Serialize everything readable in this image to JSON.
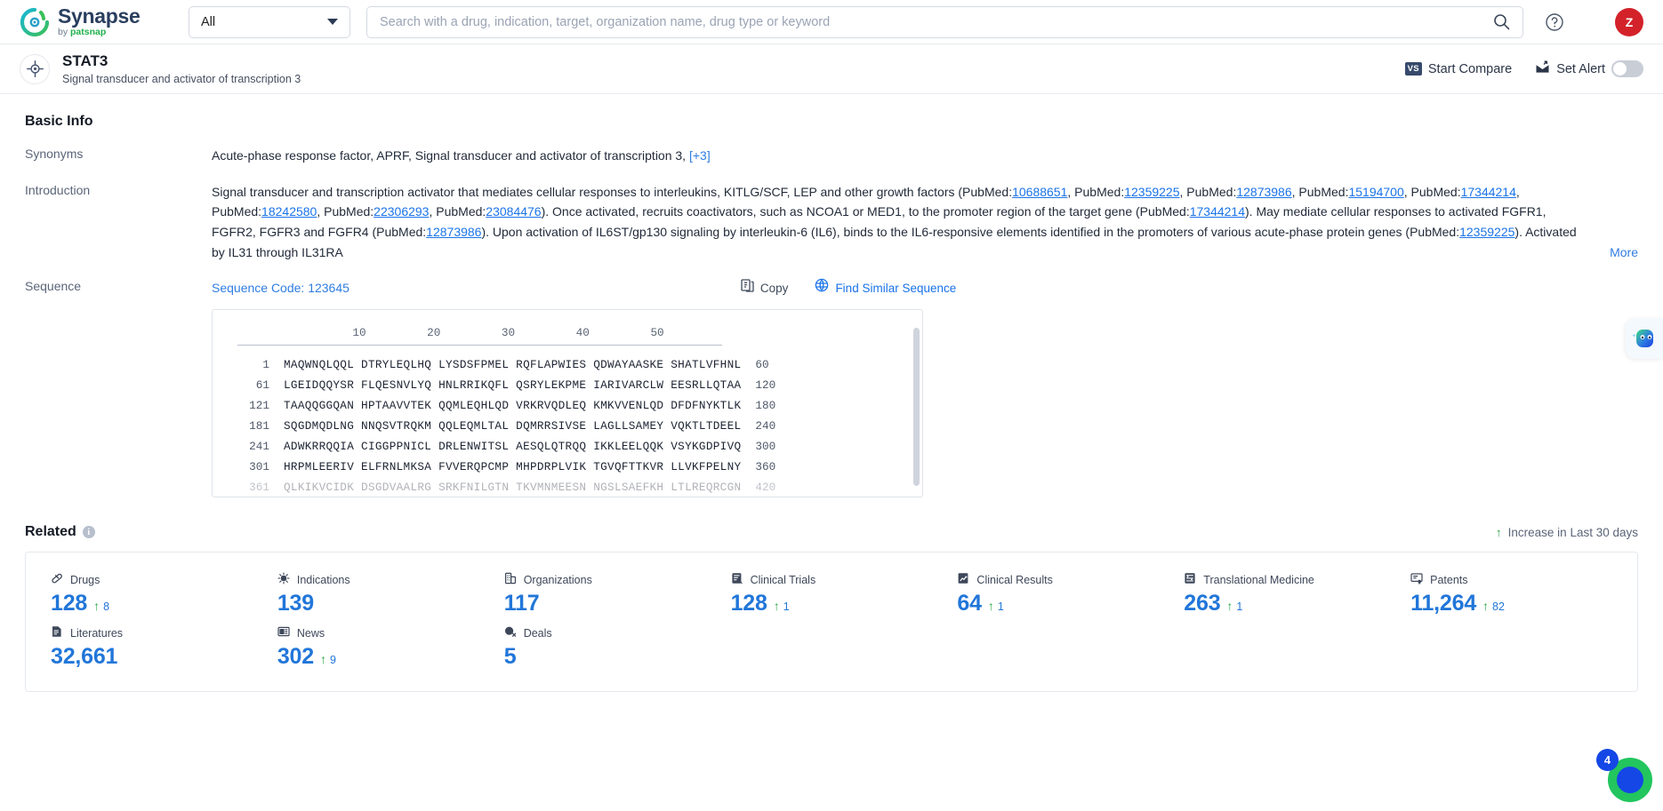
{
  "topbar": {
    "brand_name": "Synapse",
    "brand_sub_prefix": "by ",
    "brand_sub_name": "patsnap",
    "scope_value": "All",
    "search_placeholder": "Search with a drug, indication, target, organization name, drug type or keyword",
    "search_value": "",
    "avatar_initial": "Z",
    "icons": [
      "help-icon",
      "apps-grid-icon",
      "avatar"
    ]
  },
  "target_header": {
    "name": "STAT3",
    "description": "Signal transducer and activator of transcription 3",
    "compare_badge": "VS",
    "compare_label": "Start Compare",
    "alert_label": "Set Alert",
    "alert_on": false
  },
  "basic_info": {
    "title": "Basic Info",
    "synonyms_label": "Synonyms",
    "synonyms_value": "Acute-phase response factor,  APRF,  Signal transducer and activator of transcription 3,",
    "synonyms_more": "[+3]",
    "introduction_label": "Introduction",
    "introduction_more": "More",
    "introduction_parts": [
      {
        "t": "Signal transducer and transcription activator that mediates cellular responses to interleukins, KITLG/SCF, LEP and other growth factors (PubMed:"
      },
      {
        "t": "10688651",
        "link": true
      },
      {
        "t": ", PubMed:"
      },
      {
        "t": "12359225",
        "link": true
      },
      {
        "t": ", PubMed:"
      },
      {
        "t": "12873986",
        "link": true
      },
      {
        "t": ", PubMed:"
      },
      {
        "t": "15194700",
        "link": true
      },
      {
        "t": ", PubMed:"
      },
      {
        "t": "17344214",
        "link": true
      },
      {
        "t": ", PubMed:"
      },
      {
        "t": "18242580",
        "link": true
      },
      {
        "t": ", PubMed:"
      },
      {
        "t": "22306293",
        "link": true
      },
      {
        "t": ", PubMed:"
      },
      {
        "t": "23084476",
        "link": true
      },
      {
        "t": "). Once activated, recruits coactivators, such as NCOA1 or MED1, to the promoter region of the target gene (PubMed:"
      },
      {
        "t": "17344214",
        "link": true
      },
      {
        "t": "). May mediate cellular responses to activated FGFR1, FGFR2, FGFR3 and FGFR4 (PubMed:"
      },
      {
        "t": "12873986",
        "link": true
      },
      {
        "t": "). Upon activation of IL6ST/gp130 signaling by interleukin-6 (IL6), binds to the IL6-responsive elements identified in the promoters of various acute-phase protein genes (PubMed:"
      },
      {
        "t": "12359225",
        "link": true
      },
      {
        "t": "). Activated by IL31 through IL31RA"
      }
    ]
  },
  "sequence": {
    "label": "Sequence",
    "code_label": "Sequence Code: 123645",
    "copy_label": "Copy",
    "find_label": "Find Similar Sequence",
    "ruler_ticks": [
      "10",
      "20",
      "30",
      "40",
      "50"
    ],
    "rows": [
      {
        "start": "1",
        "blocks": [
          "MAQWNQLQQL",
          "DTRYLEQLHQ",
          "LYSDSFPMEL",
          "RQFLAPWIES",
          "QDWAYAASKE",
          "SHATLVFHNL"
        ],
        "end": "60"
      },
      {
        "start": "61",
        "blocks": [
          "LGEIDQQYSR",
          "FLQESNVLYQ",
          "HNLRRIKQFL",
          "QSRYLEKPME",
          "IARIVARCLW",
          "EESRLLQTAA"
        ],
        "end": "120"
      },
      {
        "start": "121",
        "blocks": [
          "TAAQQGGQAN",
          "HPTAAVVTEK",
          "QQMLEQHLQD",
          "VRKRVQDLEQ",
          "KMKVVENLQD",
          "DFDFNYKTLK"
        ],
        "end": "180"
      },
      {
        "start": "181",
        "blocks": [
          "SQGDMQDLNG",
          "NNQSVTRQKM",
          "QQLEQMLTAL",
          "DQMRRSIVSE",
          "LAGLLSAMEY",
          "VQKTLTDEEL"
        ],
        "end": "240"
      },
      {
        "start": "241",
        "blocks": [
          "ADWKRRQQIA",
          "CIGGPPNICL",
          "DRLENWITSL",
          "AESQLQTRQQ",
          "IKKLEELQQK",
          "VSYKGDPIVQ"
        ],
        "end": "300"
      },
      {
        "start": "301",
        "blocks": [
          "HRPMLEERIV",
          "ELFRNLMKSA",
          "FVVERQPCMP",
          "MHPDRPLVIK",
          "TGVQFTTKVR",
          "LLVKFPELNY"
        ],
        "end": "360"
      },
      {
        "start": "361",
        "blocks": [
          "QLKIKVCIDK",
          "DSGDVAALRG",
          "SRKFNILGTN",
          "TKVMNMEESN",
          "NGSLSAEFKH",
          "LTLREQRCGN"
        ],
        "end": "420"
      }
    ]
  },
  "related": {
    "title": "Related",
    "legend_arrow": "↑",
    "legend_label": "Increase in Last 30 days",
    "stats": [
      {
        "icon": "pill-icon",
        "label": "Drugs",
        "value": "128",
        "delta": "8"
      },
      {
        "icon": "virus-icon",
        "label": "Indications",
        "value": "139",
        "delta": ""
      },
      {
        "icon": "building-icon",
        "label": "Organizations",
        "value": "117",
        "delta": ""
      },
      {
        "icon": "clipboard-icon",
        "label": "Clinical Trials",
        "value": "128",
        "delta": "1"
      },
      {
        "icon": "results-icon",
        "label": "Clinical Results",
        "value": "64",
        "delta": "1"
      },
      {
        "icon": "translational-icon",
        "label": "Translational Medicine",
        "value": "263",
        "delta": "1"
      },
      {
        "icon": "patent-icon",
        "label": "Patents",
        "value": "11,264",
        "delta": "82"
      },
      {
        "icon": "literature-icon",
        "label": "Literatures",
        "value": "32,661",
        "delta": ""
      },
      {
        "icon": "news-icon",
        "label": "News",
        "value": "302",
        "delta": "9"
      },
      {
        "icon": "deals-icon",
        "label": "Deals",
        "value": "5",
        "delta": ""
      }
    ]
  },
  "floating": {
    "assistant_icon": "ai-assistant-icon",
    "chat_icon": "chat-bubble-icon",
    "chat_badge": "4"
  },
  "colors": {
    "accent_blue": "#2176d9",
    "link_blue": "#1a73e8",
    "increase_green": "#2aa745",
    "avatar_red": "#d3222a",
    "brand_green": "#22b04b"
  }
}
